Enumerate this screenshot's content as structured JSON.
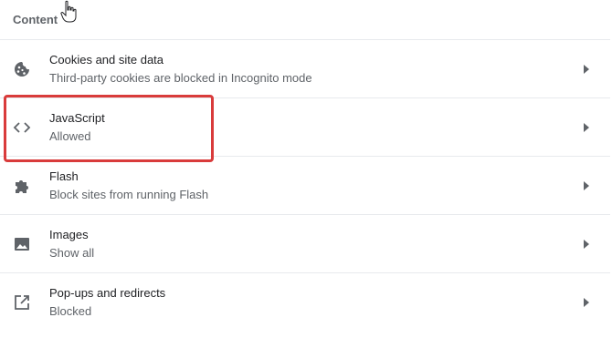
{
  "section": {
    "title": "Content"
  },
  "items": [
    {
      "label": "Cookies and site data",
      "sub": "Third-party cookies are blocked in Incognito mode",
      "icon": "cookie-icon"
    },
    {
      "label": "JavaScript",
      "sub": "Allowed",
      "icon": "code-brackets-icon"
    },
    {
      "label": "Flash",
      "sub": "Block sites from running Flash",
      "icon": "puzzle-piece-icon"
    },
    {
      "label": "Images",
      "sub": "Show all",
      "icon": "image-icon"
    },
    {
      "label": "Pop-ups and redirects",
      "sub": "Blocked",
      "icon": "open-in-new-icon"
    }
  ],
  "colors": {
    "highlight": "#d93b3b",
    "icon": "#5f6368",
    "divider": "#e8eaed"
  }
}
